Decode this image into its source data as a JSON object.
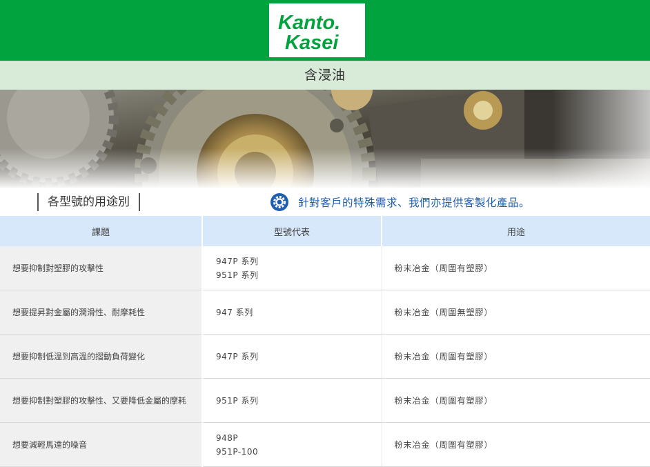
{
  "header": {
    "logo_line1": "Kanto.",
    "logo_line2": "Kasei",
    "title": "含浸油",
    "brand_color": "#00a33d"
  },
  "section": {
    "title": "各型號的用途別",
    "notice": "針對客戶的特殊需求、我們亦提供客製化產品。",
    "notice_icon": "gear-icon"
  },
  "table": {
    "headers": [
      "課題",
      "型號代表",
      "用途"
    ],
    "rows": [
      {
        "issue": "想要抑制對塑膠的攻擊性",
        "models": [
          "947P 系列",
          "951P 系列"
        ],
        "usage": "粉末冶金（周圍有塑膠）"
      },
      {
        "issue": "想要提昇對金屬的潤滑性、耐摩耗性",
        "models": [
          "947 系列"
        ],
        "usage": "粉末冶金（周圍無塑膠）"
      },
      {
        "issue": "想要抑制低溫到高溫的摺動負荷變化",
        "models": [
          "947P 系列"
        ],
        "usage": "粉末冶金（周圍有塑膠）"
      },
      {
        "issue": "想要抑制對塑膠的攻擊性、又要降低金屬的摩耗",
        "models": [
          "951P 系列"
        ],
        "usage": "粉末冶金（周圍有塑膠）"
      },
      {
        "issue": "想要減輕馬達的噪音",
        "models": [
          "948P",
          "951P-100"
        ],
        "usage": "粉末冶金（周圍有塑膠）"
      }
    ]
  }
}
